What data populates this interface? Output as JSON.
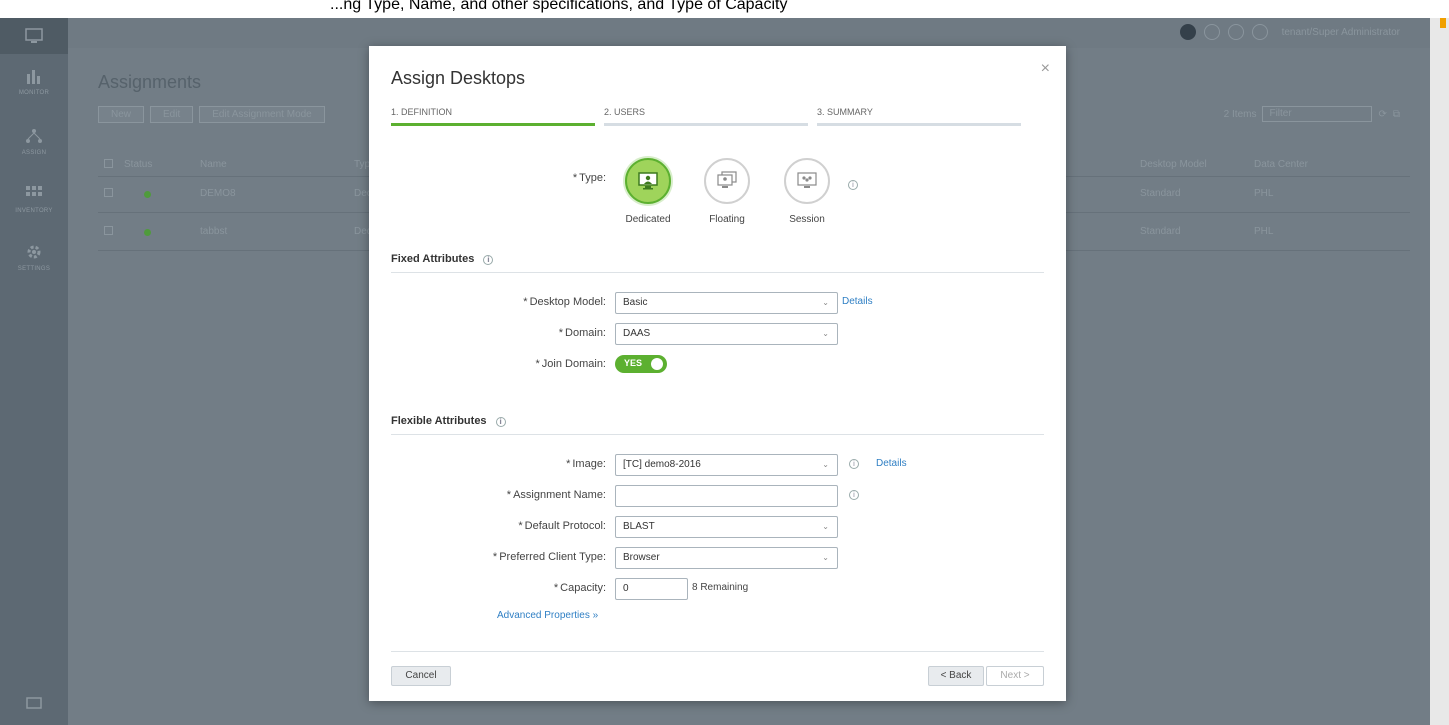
{
  "browser_strip": {
    "text": "...ng Type, Name, and other specifications, and Type of Capacity"
  },
  "background": {
    "sidebar": [
      {
        "label": "MONITOR",
        "icon": "bar-chart-icon"
      },
      {
        "label": "ASSIGN",
        "icon": "network-icon"
      },
      {
        "label": "INVENTORY",
        "icon": "grid-icon"
      },
      {
        "label": "SETTINGS",
        "icon": "gear-icon"
      }
    ],
    "user_label": "tenant/Super Administrator",
    "page_title": "Assignments",
    "toolbar": [
      "New",
      "Edit",
      "Edit Assignment Mode"
    ],
    "items_count": "2 Items",
    "filter_placeholder": "Filter",
    "columns": [
      "Status",
      "Name",
      "Typ",
      "Desktop Model",
      "Data Center"
    ],
    "rows": [
      {
        "name": "DEMO8",
        "type": "Dec",
        "model": "Standard",
        "dc": "PHL"
      },
      {
        "name": "tabbst",
        "type": "Ded",
        "model": "Standard",
        "dc": "PHL"
      }
    ]
  },
  "modal": {
    "title": "Assign Desktops",
    "close": "×",
    "steps": [
      {
        "label": "1. DEFINITION",
        "active": true
      },
      {
        "label": "2. USERS",
        "active": false
      },
      {
        "label": "3. SUMMARY",
        "active": false
      }
    ],
    "type": {
      "label": "Type:",
      "options": [
        {
          "name": "Dedicated",
          "selected": true
        },
        {
          "name": "Floating",
          "selected": false
        },
        {
          "name": "Session",
          "selected": false
        }
      ]
    },
    "fixed": {
      "title": "Fixed Attributes",
      "desktop_model": {
        "label": "Desktop Model:",
        "value": "Basic",
        "details": "Details"
      },
      "domain": {
        "label": "Domain:",
        "value": "DAAS"
      },
      "join_domain": {
        "label": "Join Domain:",
        "value": "YES"
      }
    },
    "flexible": {
      "title": "Flexible Attributes",
      "image": {
        "label": "Image:",
        "value": "[TC] demo8-2016",
        "details": "Details"
      },
      "assignment_name": {
        "label": "Assignment Name:",
        "value": ""
      },
      "default_protocol": {
        "label": "Default Protocol:",
        "value": "BLAST"
      },
      "preferred_client": {
        "label": "Preferred Client Type:",
        "value": "Browser"
      },
      "capacity": {
        "label": "Capacity:",
        "value": "0",
        "remaining": "8 Remaining"
      },
      "advanced": "Advanced Properties"
    },
    "buttons": {
      "cancel": "Cancel",
      "back": "< Back",
      "next": "Next >"
    }
  },
  "colors": {
    "accent_green": "#5cb030",
    "link_blue": "#2f7fc4",
    "overlay": "#727d86"
  }
}
